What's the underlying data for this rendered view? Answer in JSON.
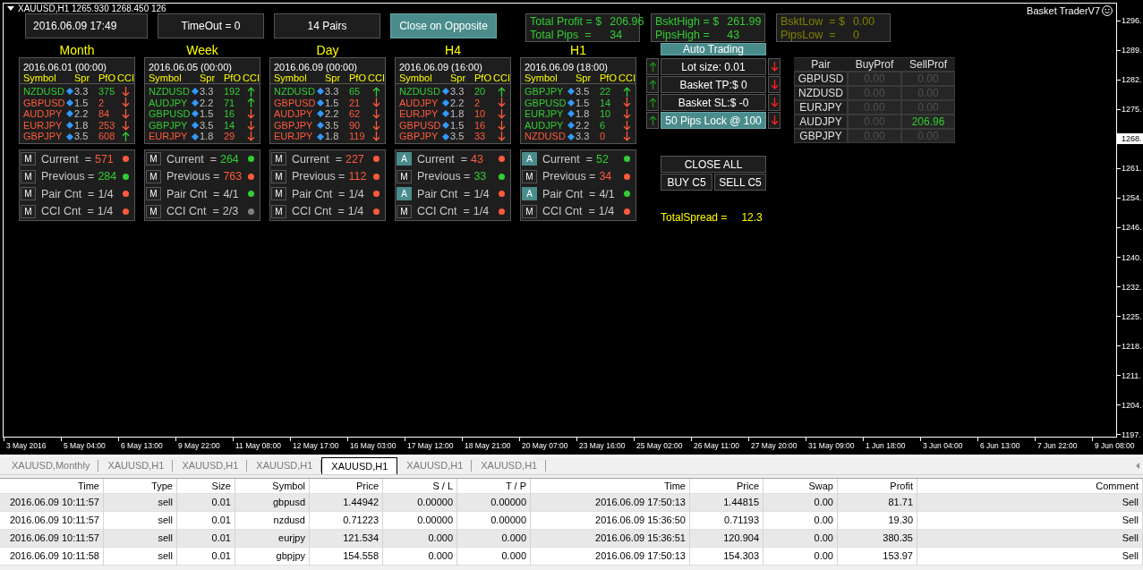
{
  "chart": {
    "header": "XAUUSD,H1 1265.930 1268.450 126",
    "brand": "Basket TraderV7",
    "top_bar": {
      "date": "2016.06.09 17:49",
      "buttons": [
        {
          "label": "TimeOut = 0",
          "active": false
        },
        {
          "label": "14 Pairs",
          "active": false
        },
        {
          "label": "Close on Opposite",
          "active": true
        }
      ]
    },
    "summary": [
      {
        "color": "#33cc33",
        "lines": [
          {
            "label": "Total Profit = $",
            "value": "206.96"
          },
          {
            "label": "Total Pips  =",
            "value": "34"
          }
        ]
      },
      {
        "color": "#33cc33",
        "lines": [
          {
            "label": "BsktHigh = $",
            "value": "261.99"
          },
          {
            "label": "PipsHigh =",
            "value": "43"
          }
        ]
      },
      {
        "color": "#808000",
        "lines": [
          {
            "label": "BsktLow  = $",
            "value": "0.00"
          },
          {
            "label": "PipsLow  =",
            "value": "0"
          }
        ]
      }
    ],
    "timeframes": [
      {
        "title": "Month",
        "date": "2016.06.01 (00:00)",
        "columns": [
          "Symbol",
          "Spr",
          "PfO",
          "CCI"
        ],
        "rows": [
          {
            "symbol": "NZDUSD",
            "color": "#33cc33",
            "spread": "3.3",
            "pfo": "375",
            "cci_up": false
          },
          {
            "symbol": "GBPUSD",
            "color": "#ff5a3c",
            "spread": "1.5",
            "pfo": "2",
            "cci_up": false
          },
          {
            "symbol": "AUDJPY",
            "color": "#ff5a3c",
            "spread": "2.2",
            "pfo": "84",
            "cci_up": false
          },
          {
            "symbol": "EURJPY",
            "color": "#ff5a3c",
            "spread": "1.8",
            "pfo": "253",
            "cci_up": false
          },
          {
            "symbol": "GBPJPY",
            "color": "#ff5a3c",
            "spread": "3.5",
            "pfo": "608",
            "cci_up": true
          }
        ],
        "status": [
          {
            "button": "M",
            "active": false,
            "label": "Current  =",
            "reading": {
              "text": "571",
              "color": "#ff5a3c"
            },
            "color": "#ff5a3c"
          },
          {
            "button": "M",
            "active": false,
            "label": "Previous =",
            "reading": {
              "text": "284",
              "color": "#33cc33"
            },
            "color": "#33cc33"
          },
          {
            "button": "M",
            "active": false,
            "label": "Pair Cnt  =",
            "reading": {
              "text": "1/4",
              "color": "#c8c8c8"
            },
            "color": "#ff5a3c"
          },
          {
            "button": "M",
            "active": false,
            "label": "CCI Cnt  =",
            "reading": {
              "text": "1/4",
              "color": "#c8c8c8"
            },
            "color": "#ff5a3c"
          }
        ]
      },
      {
        "title": "Week",
        "date": "2016.06.05 (00:00)",
        "columns": [
          "Symbol",
          "Spr",
          "PfO",
          "CCI"
        ],
        "rows": [
          {
            "symbol": "NZDUSD",
            "color": "#33cc33",
            "spread": "3.3",
            "pfo": "192",
            "cci_up": true
          },
          {
            "symbol": "AUDJPY",
            "color": "#33cc33",
            "spread": "2.2",
            "pfo": "71",
            "cci_up": true
          },
          {
            "symbol": "GBPUSD",
            "color": "#33cc33",
            "spread": "1.5",
            "pfo": "16",
            "cci_up": false
          },
          {
            "symbol": "GBPJPY",
            "color": "#33cc33",
            "spread": "3.5",
            "pfo": "14",
            "cci_up": false
          },
          {
            "symbol": "EURJPY",
            "color": "#ff5a3c",
            "spread": "1.8",
            "pfo": "29",
            "cci_up": false
          }
        ],
        "status": [
          {
            "button": "M",
            "active": false,
            "label": "Current  =",
            "reading": {
              "text": "264",
              "color": "#33cc33"
            },
            "color": "#33cc33"
          },
          {
            "button": "M",
            "active": false,
            "label": "Previous =",
            "reading": {
              "text": "763",
              "color": "#ff5a3c"
            },
            "color": "#ff5a3c"
          },
          {
            "button": "M",
            "active": false,
            "label": "Pair Cnt  =",
            "reading": {
              "text": "4/1",
              "color": "#c8c8c8"
            },
            "color": "#33cc33"
          },
          {
            "button": "M",
            "active": false,
            "label": "CCI Cnt  =",
            "reading": {
              "text": "2/3",
              "color": "#c8c8c8"
            },
            "color": "#808080"
          }
        ]
      },
      {
        "title": "Day",
        "date": "2016.06.09 (00:00)",
        "columns": [
          "Symbol",
          "Spr",
          "PfO",
          "CCI"
        ],
        "rows": [
          {
            "symbol": "NZDUSD",
            "color": "#33cc33",
            "spread": "3.3",
            "pfo": "65",
            "cci_up": true
          },
          {
            "symbol": "GBPUSD",
            "color": "#ff5a3c",
            "spread": "1.5",
            "pfo": "21",
            "cci_up": false
          },
          {
            "symbol": "AUDJPY",
            "color": "#ff5a3c",
            "spread": "2.2",
            "pfo": "62",
            "cci_up": false
          },
          {
            "symbol": "GBPJPY",
            "color": "#ff5a3c",
            "spread": "3.5",
            "pfo": "90",
            "cci_up": false
          },
          {
            "symbol": "EURJPY",
            "color": "#ff5a3c",
            "spread": "1.8",
            "pfo": "119",
            "cci_up": false
          }
        ],
        "status": [
          {
            "button": "M",
            "active": false,
            "label": "Current  =",
            "reading": {
              "text": "227",
              "color": "#ff5a3c"
            },
            "color": "#ff5a3c"
          },
          {
            "button": "M",
            "active": false,
            "label": "Previous =",
            "reading": {
              "text": "112",
              "color": "#ff5a3c"
            },
            "color": "#ff5a3c"
          },
          {
            "button": "M",
            "active": false,
            "label": "Pair Cnt  =",
            "reading": {
              "text": "1/4",
              "color": "#c8c8c8"
            },
            "color": "#ff5a3c"
          },
          {
            "button": "M",
            "active": false,
            "label": "CCI Cnt  =",
            "reading": {
              "text": "1/4",
              "color": "#c8c8c8"
            },
            "color": "#ff5a3c"
          }
        ]
      },
      {
        "title": "H4",
        "date": "2016.06.09 (16:00)",
        "columns": [
          "Symbol",
          "Spr",
          "PfO",
          "CCI"
        ],
        "rows": [
          {
            "symbol": "NZDUSD",
            "color": "#33cc33",
            "spread": "3.3",
            "pfo": "20",
            "cci_up": true
          },
          {
            "symbol": "AUDJPY",
            "color": "#ff5a3c",
            "spread": "2.2",
            "pfo": "2",
            "cci_up": false
          },
          {
            "symbol": "EURJPY",
            "color": "#ff5a3c",
            "spread": "1.8",
            "pfo": "10",
            "cci_up": false
          },
          {
            "symbol": "GBPUSD",
            "color": "#ff5a3c",
            "spread": "1.5",
            "pfo": "16",
            "cci_up": false
          },
          {
            "symbol": "GBPJPY",
            "color": "#ff5a3c",
            "spread": "3.5",
            "pfo": "33",
            "cci_up": false
          }
        ],
        "status": [
          {
            "button": "A",
            "active": true,
            "label": "Current  =",
            "reading": {
              "text": "43",
              "color": "#ff5a3c"
            },
            "color": "#ff5a3c"
          },
          {
            "button": "M",
            "active": false,
            "label": "Previous =",
            "reading": {
              "text": "33",
              "color": "#33cc33"
            },
            "color": "#33cc33"
          },
          {
            "button": "A",
            "active": true,
            "label": "Pair Cnt  =",
            "reading": {
              "text": "1/4",
              "color": "#c8c8c8"
            },
            "color": "#ff5a3c"
          },
          {
            "button": "M",
            "active": false,
            "label": "CCI Cnt  =",
            "reading": {
              "text": "1/4",
              "color": "#c8c8c8"
            },
            "color": "#ff5a3c"
          }
        ]
      },
      {
        "title": "H1",
        "date": "2016.06.09 (18:00)",
        "columns": [
          "Symbol",
          "Spr",
          "PfO",
          "CCI"
        ],
        "rows": [
          {
            "symbol": "GBPJPY",
            "color": "#33cc33",
            "spread": "3.5",
            "pfo": "22",
            "cci_up": true
          },
          {
            "symbol": "GBPUSD",
            "color": "#33cc33",
            "spread": "1.5",
            "pfo": "14",
            "cci_up": false
          },
          {
            "symbol": "EURJPY",
            "color": "#33cc33",
            "spread": "1.8",
            "pfo": "10",
            "cci_up": false
          },
          {
            "symbol": "AUDJPY",
            "color": "#33cc33",
            "spread": "2.2",
            "pfo": "6",
            "cci_up": false
          },
          {
            "symbol": "NZDUSD",
            "color": "#ff5a3c",
            "spread": "3.3",
            "pfo": "0",
            "cci_up": false
          }
        ],
        "status": [
          {
            "button": "A",
            "active": true,
            "label": "Current  =",
            "reading": {
              "text": "52",
              "color": "#33cc33"
            },
            "color": "#33cc33"
          },
          {
            "button": "M",
            "active": false,
            "label": "Previous =",
            "reading": {
              "text": "34",
              "color": "#ff5a3c"
            },
            "color": "#ff5a3c"
          },
          {
            "button": "A",
            "active": true,
            "label": "Pair Cnt  =",
            "reading": {
              "text": "4/1",
              "color": "#c8c8c8"
            },
            "color": "#33cc33"
          },
          {
            "button": "M",
            "active": false,
            "label": "CCI Cnt  =",
            "reading": {
              "text": "1/4",
              "color": "#c8c8c8"
            },
            "color": "#ff5a3c"
          }
        ]
      }
    ],
    "controls": {
      "auto_trading": {
        "label": "Auto Trading",
        "active": true
      },
      "settings": [
        {
          "label": "Lot size: 0.01",
          "active": false
        },
        {
          "label": "Basket TP:$ 0",
          "active": false
        },
        {
          "label": "Basket SL:$ -0",
          "active": false
        },
        {
          "label": "50 Pips Lock @ 100",
          "active": true
        }
      ],
      "close_all": "CLOSE ALL",
      "buy": "BUY C5",
      "sell": "SELL C5",
      "spread": {
        "label": "TotalSpread =",
        "value": "12.3"
      }
    },
    "pair_table": {
      "columns": [
        "Pair",
        "BuyProf",
        "SellProf"
      ],
      "rows": [
        {
          "pair": "GBPUSD",
          "buy": {
            "value": "0.00",
            "active": false
          },
          "sell": {
            "value": "0.00",
            "active": false
          }
        },
        {
          "pair": "NZDUSD",
          "buy": {
            "value": "0.00",
            "active": false
          },
          "sell": {
            "value": "0.00",
            "active": false
          }
        },
        {
          "pair": "EURJPY",
          "buy": {
            "value": "0.00",
            "active": false
          },
          "sell": {
            "value": "0.00",
            "active": false
          }
        },
        {
          "pair": "AUDJPY",
          "buy": {
            "value": "0.00",
            "active": false
          },
          "sell": {
            "value": "206.96",
            "active": true
          }
        },
        {
          "pair": "GBPJPY",
          "buy": {
            "value": "0.00",
            "active": false
          },
          "sell": {
            "value": "0.00",
            "active": false
          }
        }
      ]
    },
    "price_axis": [
      {
        "label": "1296.",
        "highlighted": false
      },
      {
        "label": "1289.",
        "highlighted": false
      },
      {
        "label": "1282.",
        "highlighted": false
      },
      {
        "label": "1275.",
        "highlighted": false
      },
      {
        "label": "1268.",
        "highlighted": true
      },
      {
        "label": "1261.",
        "highlighted": false
      },
      {
        "label": "1254.",
        "highlighted": false
      },
      {
        "label": "1246.",
        "highlighted": false
      },
      {
        "label": "1240.",
        "highlighted": false
      },
      {
        "label": "1232.",
        "highlighted": false
      },
      {
        "label": "1225.",
        "highlighted": false
      },
      {
        "label": "1218.",
        "highlighted": false
      },
      {
        "label": "1211.",
        "highlighted": false
      },
      {
        "label": "1204.",
        "highlighted": false
      },
      {
        "label": "1197.",
        "highlighted": false
      }
    ],
    "time_axis": [
      "3 May 2016",
      "5 May 04:00",
      "6 May 13:00",
      "9 May 22:00",
      "11 May 08:00",
      "12 May 17:00",
      "16 May 03:00",
      "17 May 12:00",
      "18 May 21:00",
      "20 May 07:00",
      "23 May 16:00",
      "25 May 02:00",
      "26 May 11:00",
      "27 May 20:00",
      "31 May 09:00",
      "1 Jun 18:00",
      "3 Jun 04:00",
      "6 Jun 13:00",
      "7 Jun 22:00",
      "9 Jun 08:00"
    ]
  },
  "tabs": [
    {
      "label": "XAUUSD,Monthly",
      "selected": false
    },
    {
      "label": "XAUUSD,H1",
      "selected": false
    },
    {
      "label": "XAUUSD,H1",
      "selected": false
    },
    {
      "label": "XAUUSD,H1",
      "selected": false
    },
    {
      "label": "XAUUSD,H1",
      "selected": true
    },
    {
      "label": "XAUUSD,H1",
      "selected": false
    },
    {
      "label": "XAUUSD,H1",
      "selected": false
    }
  ],
  "trades": {
    "columns": [
      "Time",
      "Type",
      "Size",
      "Symbol",
      "Price",
      "S / L",
      "T / P",
      "Time",
      "Price",
      "Swap",
      "Profit",
      "Comment"
    ],
    "rows": [
      [
        "2016.06.09 10:11:57",
        "sell",
        "0.01",
        "gbpusd",
        "1.44942",
        "0.00000",
        "0.00000",
        "2016.06.09 17:50:13",
        "1.44815",
        "0.00",
        "81.71",
        "Sell"
      ],
      [
        "2016.06.09 10:11:57",
        "sell",
        "0.01",
        "nzdusd",
        "0.71223",
        "0.00000",
        "0.00000",
        "2016.06.09 15:36:50",
        "0.71193",
        "0.00",
        "19.30",
        "Sell"
      ],
      [
        "2016.06.09 10:11:57",
        "sell",
        "0.01",
        "eurjpy",
        "121.534",
        "0.000",
        "0.000",
        "2016.06.09 15:36:51",
        "120.904",
        "0.00",
        "380.35",
        "Sell"
      ],
      [
        "2016.06.09 10:11:58",
        "sell",
        "0.01",
        "gbpjpy",
        "154.558",
        "0.000",
        "0.000",
        "2016.06.09 17:50:13",
        "154.303",
        "0.00",
        "153.97",
        "Sell"
      ]
    ]
  }
}
